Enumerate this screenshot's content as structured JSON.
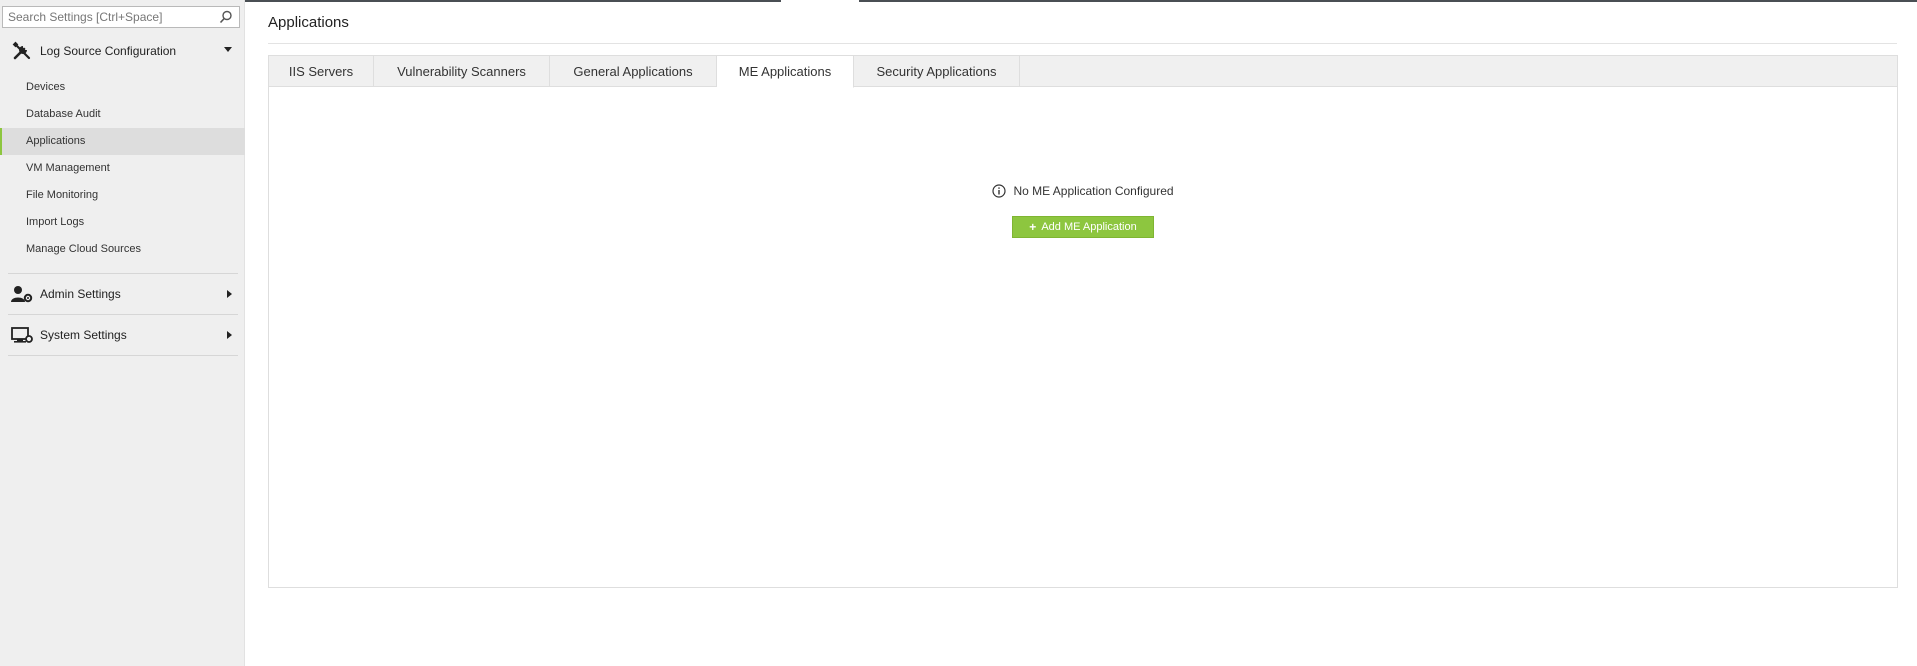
{
  "search": {
    "placeholder": "Search Settings [Ctrl+Space]"
  },
  "sidebar": {
    "log_source": {
      "label": "Log Source Configuration",
      "icon": "tools-icon",
      "items": [
        {
          "label": "Devices"
        },
        {
          "label": "Database Audit"
        },
        {
          "label": "Applications",
          "active": true
        },
        {
          "label": "VM Management"
        },
        {
          "label": "File Monitoring"
        },
        {
          "label": "Import Logs"
        },
        {
          "label": "Manage Cloud Sources"
        }
      ]
    },
    "admin": {
      "label": "Admin Settings",
      "icon": "user-gear-icon"
    },
    "system": {
      "label": "System Settings",
      "icon": "monitor-gear-icon"
    }
  },
  "main": {
    "title": "Applications",
    "tabs": [
      {
        "label": "IIS Servers"
      },
      {
        "label": "Vulnerability Scanners"
      },
      {
        "label": "General Applications"
      },
      {
        "label": "ME Applications",
        "active": true
      },
      {
        "label": "Security Applications"
      }
    ],
    "empty_message": "No ME Application Configured",
    "add_button": "Add ME Application"
  },
  "colors": {
    "accent": "#8dc63f",
    "sidebar_bg": "#efefef",
    "tabbar_bg": "#f0f0f0"
  }
}
